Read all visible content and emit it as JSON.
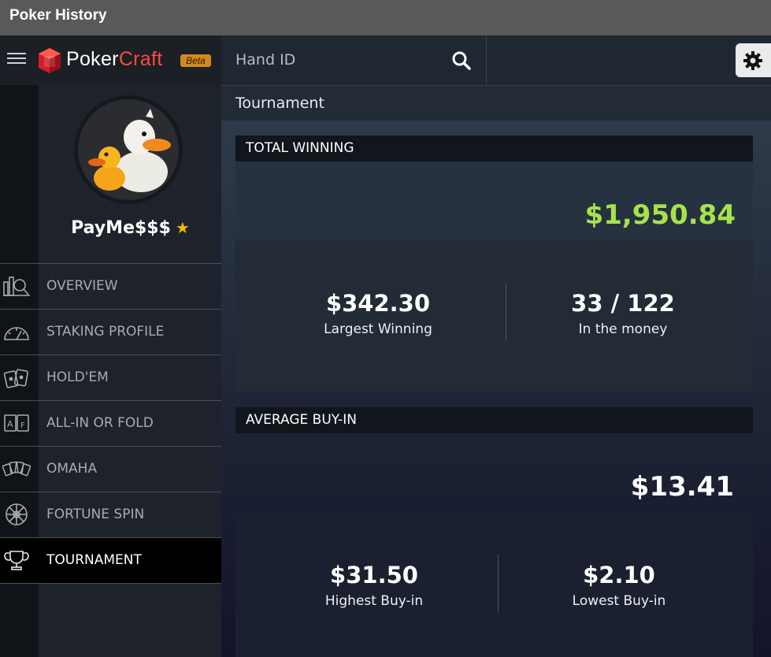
{
  "window": {
    "title": "Poker History"
  },
  "brand": {
    "name_part1": "Poker",
    "name_part2": "Craft",
    "badge": "Beta"
  },
  "user": {
    "name": "PayMe$$$"
  },
  "nav": {
    "items": [
      {
        "label": "OVERVIEW",
        "icon": "overview-icon"
      },
      {
        "label": "STAKING PROFILE",
        "icon": "gauge-icon"
      },
      {
        "label": "HOLD'EM",
        "icon": "cards-icon"
      },
      {
        "label": "ALL-IN OR FOLD",
        "icon": "af-cards-icon"
      },
      {
        "label": "OMAHA",
        "icon": "omaha-cards-icon"
      },
      {
        "label": "FORTUNE SPIN",
        "icon": "wheel-icon"
      },
      {
        "label": "TOURNAMENT",
        "icon": "trophy-icon"
      }
    ],
    "active": "TOURNAMENT"
  },
  "search": {
    "placeholder": "Hand ID"
  },
  "section": {
    "title": "Tournament"
  },
  "total_winning": {
    "header": "TOTAL WINNING",
    "value": "$1,950.84",
    "value_color": "#a6e34a",
    "largest_value": "$342.30",
    "largest_label": "Largest Winning",
    "itm_value": "33 / 122",
    "itm_label": "In the money"
  },
  "average_buyin": {
    "header": "AVERAGE BUY-IN",
    "value": "$13.41",
    "highest_value": "$31.50",
    "highest_label": "Highest Buy-in",
    "lowest_value": "$2.10",
    "lowest_label": "Lowest Buy-in"
  }
}
